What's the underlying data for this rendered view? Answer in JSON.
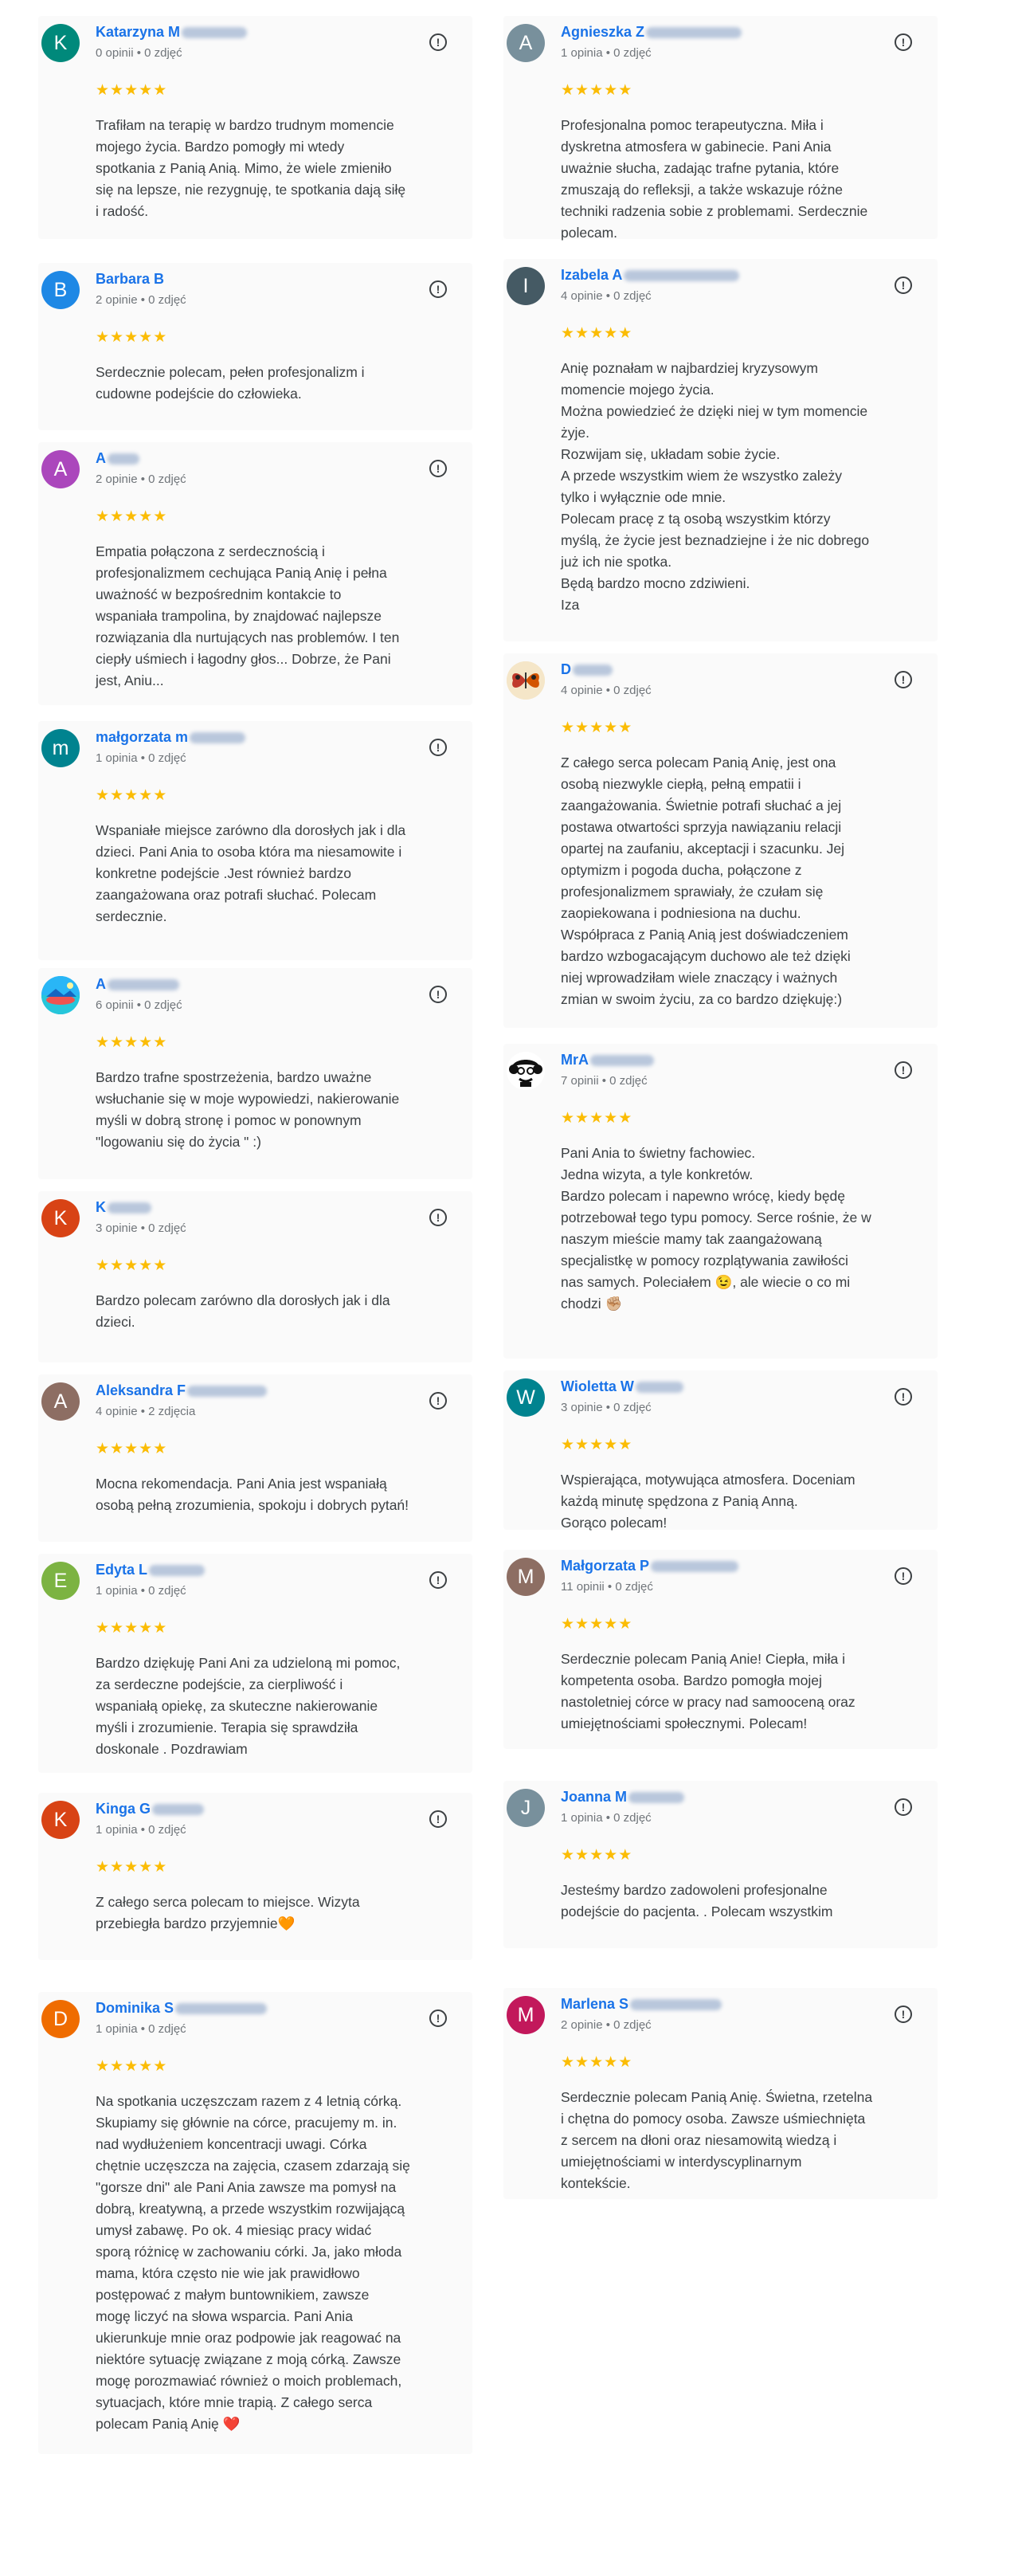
{
  "reviews_left": [
    {
      "initial": "K",
      "color": "#00897b",
      "name": "Katarzyna M",
      "stats": "0 opinii • 0 zdjęć",
      "rating": 5,
      "text": "Trafiłam na terapię w bardzo trudnym momencie\nmojego życia. Bardzo pomogły mi wtedy\nspotkania z Panią Anią. Mimo, że wiele zmieniło\nsię na lepsze, nie rezygnuję, te spotkania dają siłę\ni radość."
    },
    {
      "initial": "B",
      "color": "#1e88e5",
      "name": "Barbara B",
      "stats": "2 opinie • 0 zdjęć",
      "rating": 5,
      "text": "Serdecznie polecam, pełen profesjonalizm i\ncudowne podejście do człowieka."
    },
    {
      "initial": "A",
      "color": "#ab47bc",
      "name": "A",
      "stats": "2 opinie • 0 zdjęć",
      "rating": 5,
      "text": "Empatia połączona z serdecznością i\nprofesjonalizmem cechująca Panią Anię i pełna\nuważność w bezpośrednim kontakcie to\nwspaniała trampolina, by znajdować najlepsze\nrozwiązania dla nurtujących nas problemów. I ten\nciepły uśmiech i łagodny głos... Dobrze, że Pani\njest, Aniu..."
    },
    {
      "initial": "m",
      "color": "#00838f",
      "name": "małgorzata m",
      "stats": "1 opinia • 0 zdjęć",
      "rating": 5,
      "text": "Wspaniałe miejsce zarówno dla dorosłych jak i dla\ndzieci. Pani Ania to osoba która ma niesamowite i\nkonkretne podejście .Jest również bardzo\nzaangażowana oraz potrafi słuchać. Polecam\nserdecznie."
    },
    {
      "initial": "A",
      "color": "#29b6f6",
      "avatar_icon": "landscape-photo-icon",
      "name": "A",
      "stats": "6 opinii • 0 zdjęć",
      "rating": 5,
      "text": "Bardzo trafne spostrzeżenia, bardzo uważne\nwsłuchanie się w moje wypowiedzi, nakierowanie\nmyśli w dobrą stronę i pomoc w ponownym\n\"logowaniu się do życia \" :)"
    },
    {
      "initial": "K",
      "color": "#d84315",
      "name": "K",
      "stats": "3 opinie • 0 zdjęć",
      "rating": 5,
      "text": "Bardzo polecam zarówno dla dorosłych jak i dla\ndzieci."
    },
    {
      "initial": "A",
      "color": "#8d6e63",
      "name": "Aleksandra F",
      "stats": "4 opinie • 2 zdjęcia",
      "rating": 5,
      "text": "Mocna rekomendacja. Pani Ania jest wspaniałą\nosobą pełną zrozumienia, spokoju i dobrych pytań!"
    },
    {
      "initial": "E",
      "color": "#7cb342",
      "name": "Edyta L",
      "stats": "1 opinia • 0 zdjęć",
      "rating": 5,
      "text": "Bardzo dziękuję Pani Ani za udzieloną mi pomoc,\nza serdeczne podejście, za cierpliwość i\nwspaniałą opiekę, za skuteczne nakierowanie\nmyśli i zrozumienie. Terapia się sprawdziła\ndoskonale . Pozdrawiam"
    },
    {
      "initial": "K",
      "color": "#d84315",
      "name": "Kinga G",
      "stats": "1 opinia • 0 zdjęć",
      "rating": 5,
      "text": "Z całego serca polecam to miejsce. Wizyta\nprzebiegła bardzo przyjemnie🧡"
    },
    {
      "initial": "D",
      "color": "#ef6c00",
      "name": "Dominika S",
      "stats": "1 opinia • 0 zdjęć",
      "rating": 5,
      "text": "Na spotkania uczęszczam razem z 4 letnią córką.\nSkupiamy się głównie na córce, pracujemy m. in.\nnad wydłużeniem koncentracji uwagi. Córka\nchętnie uczęszcza na zajęcia, czasem zdarzają się\n\"gorsze dni\" ale Pani Ania zawsze ma pomysł na\ndobrą, kreatywną, a przede wszystkim rozwijającą\numysł zabawę. Po ok. 4 miesiąc pracy widać\nsporą różnicę w zachowaniu córki. Ja, jako młoda\nmama, która często nie wie jak prawidłowo\npostępować z małym buntownikiem, zawsze\nmogę liczyć na słowa wsparcia. Pani Ania\nukierunkuje mnie oraz podpowie jak reagować na\nniektóre sytuację związane z moją córką. Zawsze\nmogę porozmawiać również o moich problemach,\nsytuacjach, które mnie trapią. Z całego serca\npolecam Panią Anię ❤️"
    }
  ],
  "reviews_right": [
    {
      "initial": "A",
      "color": "#78909c",
      "name": "Agnieszka Z",
      "stats": "1 opinia • 0 zdjęć",
      "rating": 5,
      "text": "Profesjonalna pomoc terapeutyczna. Miła i\ndyskretna atmosfera w gabinecie. Pani Ania\nuważnie słucha, zadając trafne pytania, które\nzmuszają do refleksji, a także wskazuje różne\ntechniki radzenia sobie z problemami. Serdecznie\npolecam."
    },
    {
      "initial": "I",
      "color": "#455a64",
      "name": "Izabela A",
      "stats": "4 opinie • 0 zdjęć",
      "rating": 5,
      "text": "Anię poznałam w najbardziej kryzysowym\nmomencie mojego życia.\nMożna powiedzieć że dzięki niej w tym momencie\nżyje.\nRozwijam się, układam sobie życie.\nA przede wszystkim wiem że wszystko zależy\ntylko i wyłącznie ode mnie.\nPolecam pracę z tą osobą wszystkim którzy\nmyślą, że życie jest beznadziejne i że nic dobrego\njuż ich nie spotka.\nBędą bardzo mocno zdziwieni.\nIza"
    },
    {
      "initial": "D",
      "color": "#f5e6c8",
      "avatar_icon": "butterfly-photo-icon",
      "name": "D",
      "stats": "4 opinie • 0 zdjęć",
      "rating": 5,
      "text": "Z całego serca polecam Panią Anię, jest ona\nosobą niezwykle ciepłą, pełną empatii i\nzaangażowania. Świetnie potrafi słuchać a jej\npostawa otwartości sprzyja nawiązaniu relacji\nopartej na zaufaniu, akceptacji i szacunku. Jej\noptymizm i pogoda ducha, połączone z\nprofesjonalizmem sprawiały, że czułam się\nzaopiekowana i podniesiona na duchu.\nWspółpraca z Panią Anią jest doświadczeniem\nbardzo wzbogacającym duchowo ale też dzięki\nniej wprowadziłam wiele znaczący i ważnych\nzmian w swoim życiu, za co bardzo dziękuję:)"
    },
    {
      "initial": "M",
      "color": "#ffffff",
      "avatar_icon": "cartoon-face-icon",
      "name": "MrA",
      "stats": "7 opinii • 0 zdjęć",
      "rating": 5,
      "text": "Pani Ania to świetny fachowiec.\nJedna wizyta, a tyle konkretów.\nBardzo polecam i napewno wrócę, kiedy będę\npotrzebował tego typu pomocy. Serce rośnie, że w\nnaszym mieście mamy tak zaangażowaną\nspecjalistkę w pomocy rozplątywania zawiłości\nnas samych. Poleciałem 😉, ale wiecie o co mi\nchodzi ✊🏼"
    },
    {
      "initial": "W",
      "color": "#00838f",
      "name": "Wioletta W",
      "stats": "3 opinie • 0 zdjęć",
      "rating": 5,
      "text": "Wspierająca, motywująca atmosfera. Doceniam\nkażdą minutę spędzona z Panią Anną.\nGorąco polecam!"
    },
    {
      "initial": "M",
      "color": "#8d6e63",
      "name": "Małgorzata P",
      "stats": "11 opinii • 0 zdjęć",
      "rating": 5,
      "text": "Serdecznie polecam Panią Anie! Ciepła, miła i\nkompetenta osoba. Bardzo pomogła mojej\nnastoletniej córce w pracy nad samooceną oraz\numiejętnościami społecznymi. Polecam!"
    },
    {
      "initial": "J",
      "color": "#78909c",
      "name": "Joanna M",
      "stats": "1 opinia • 0 zdjęć",
      "rating": 5,
      "text": "Jesteśmy bardzo zadowoleni profesjonalne\npodejście do pacjenta. . Polecam wszystkim"
    },
    {
      "initial": "M",
      "color": "#c2185b",
      "name": "Marlena S",
      "stats": "2 opinie • 0 zdjęć",
      "rating": 5,
      "text": "Serdecznie polecam Panią Anię. Świetna, rzetelna\ni chętna do pomocy osoba. Zawsze uśmiechnięta\nz sercem na dłoni oraz niesamowitą wiedzą i\numiejętnościami w interdyscyplinarnym\nkontekście."
    }
  ],
  "star_glyph": "★",
  "more_glyph": "!"
}
